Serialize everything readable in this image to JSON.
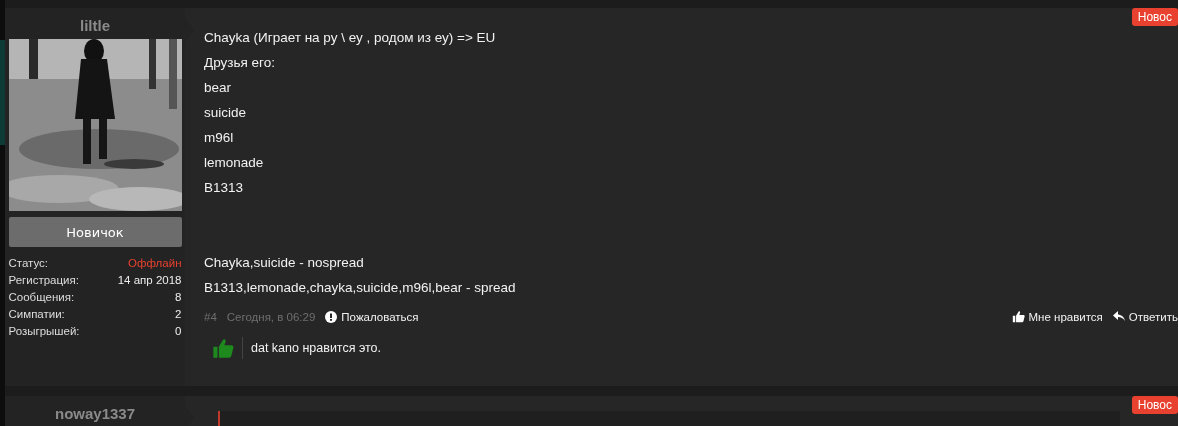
{
  "posts": [
    {
      "user": {
        "name": "liltle",
        "rank": "Новичок",
        "stats": [
          {
            "label": "Статус:",
            "value": "Оффлайн",
            "kind": "status"
          },
          {
            "label": "Регистрация:",
            "value": "14 апр 2018",
            "kind": "plain"
          },
          {
            "label": "Сообщения:",
            "value": "8",
            "kind": "plain"
          },
          {
            "label": "Симпатии:",
            "value": "2",
            "kind": "plain"
          },
          {
            "label": "Розыгрышей:",
            "value": "0",
            "kind": "plain"
          }
        ]
      },
      "badge": "Новос",
      "paragraphs": [
        [
          "Chayka (Играет на ру \\ еу , родом из еу) => EU",
          "Друзья его:",
          "bear",
          "suicide",
          "m96l",
          "lemonade",
          "B1313"
        ],
        [
          "Chayka,suicide - nospread",
          "B1313,lemonade,chayka,suicide,m96l,bear - spread"
        ]
      ],
      "footer": {
        "number": "#4",
        "date": "Сегодня, в 06:29",
        "report": "Пожаловаться",
        "like": "Мне нравится",
        "reply": "Ответить"
      },
      "likes": "dat kano нравится это."
    },
    {
      "user": {
        "name": "noway1337"
      },
      "badge": "Новос",
      "quote": true
    }
  ]
}
